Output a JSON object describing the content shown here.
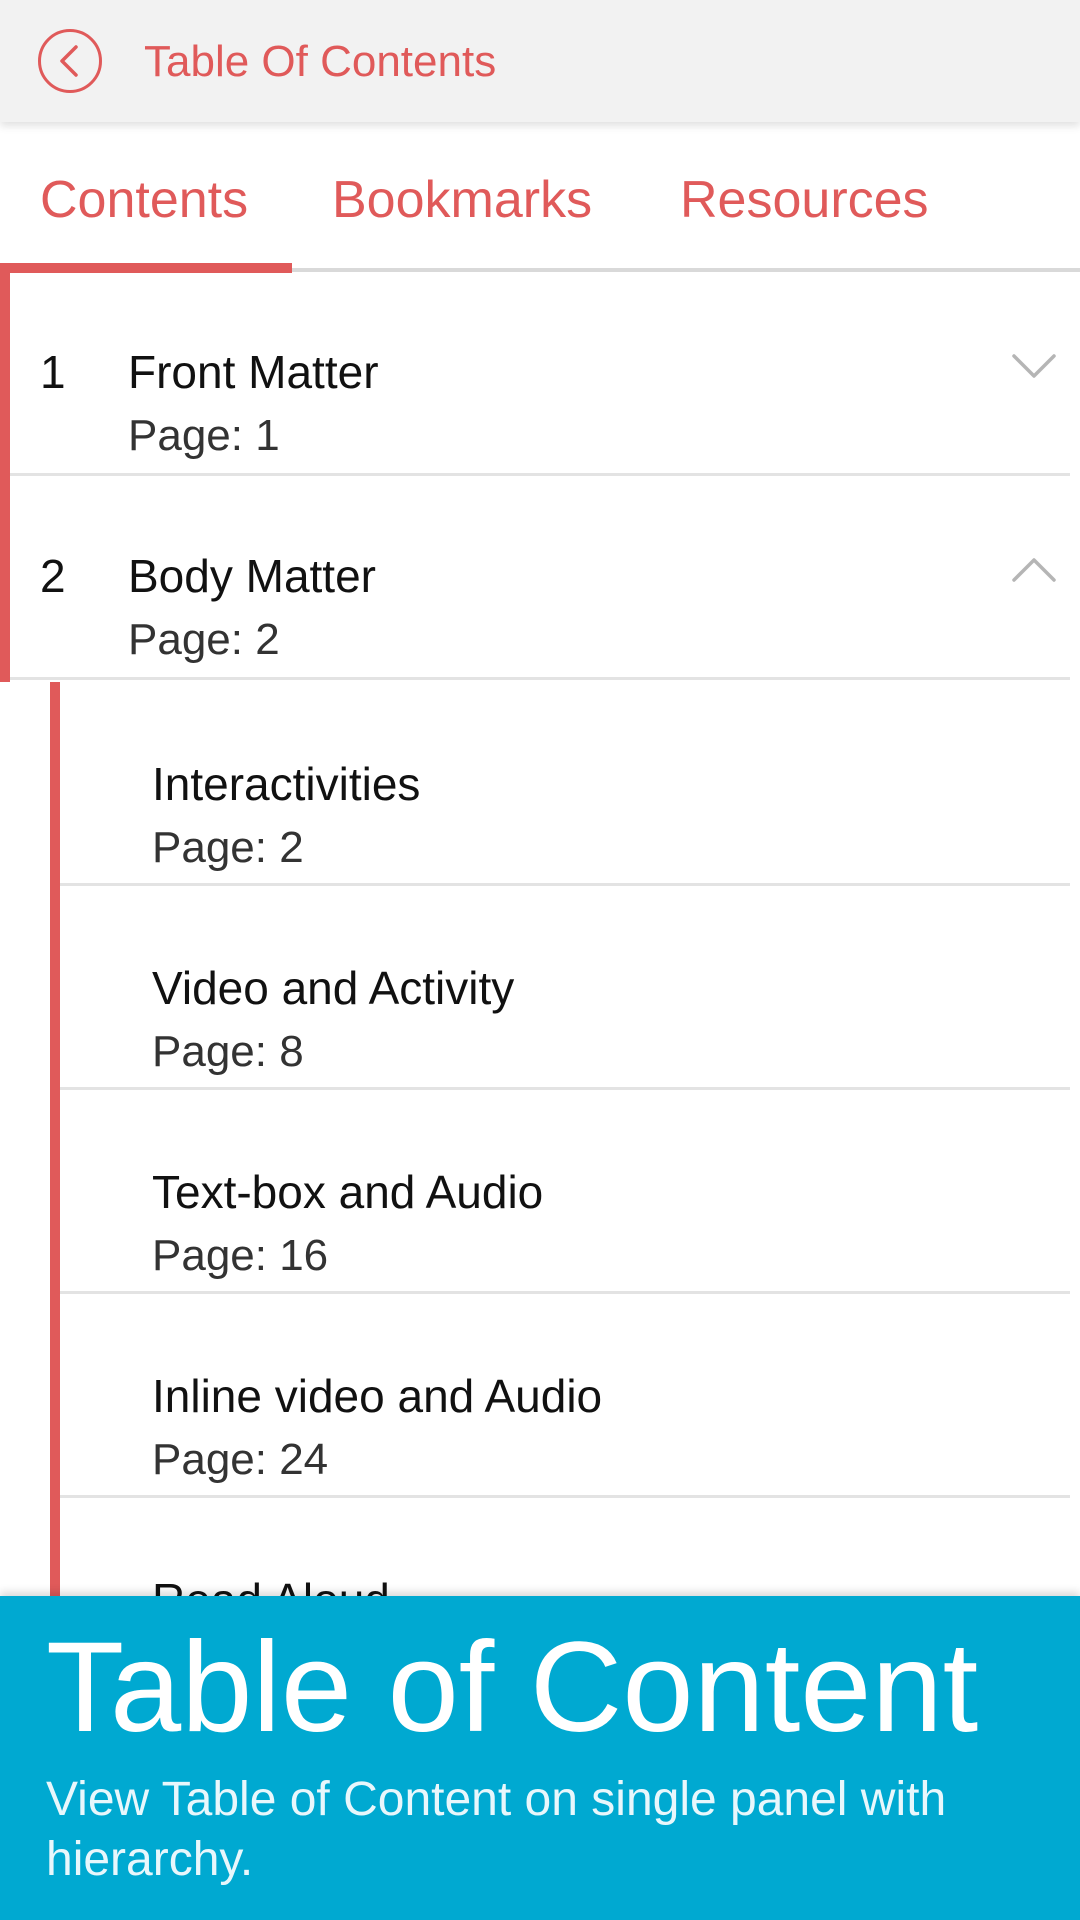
{
  "header": {
    "title": "Table Of Contents",
    "back_icon": "chevron-left-circle-icon"
  },
  "tabs": [
    {
      "label": "Contents",
      "active": true
    },
    {
      "label": "Bookmarks",
      "active": false
    },
    {
      "label": "Resources",
      "active": false
    }
  ],
  "toc": {
    "items": [
      {
        "number": "1",
        "title": "Front Matter",
        "page": "Page: 1",
        "expanded": false
      },
      {
        "number": "2",
        "title": "Body Matter",
        "page": "Page: 2",
        "expanded": true
      }
    ],
    "subitems": [
      {
        "title": "Interactivities",
        "page": "Page: 2"
      },
      {
        "title": "Video and Activity",
        "page": "Page: 8"
      },
      {
        "title": "Text-box and Audio",
        "page": "Page: 16"
      },
      {
        "title": "Inline video and Audio",
        "page": "Page: 24"
      },
      {
        "title": "Read Aloud",
        "page": ""
      }
    ]
  },
  "banner": {
    "title": "Table of Content",
    "subtitle": "View Table of Content on single panel with hierarchy."
  },
  "colors": {
    "accent": "#e05a5a",
    "banner": "#00a9d1"
  }
}
